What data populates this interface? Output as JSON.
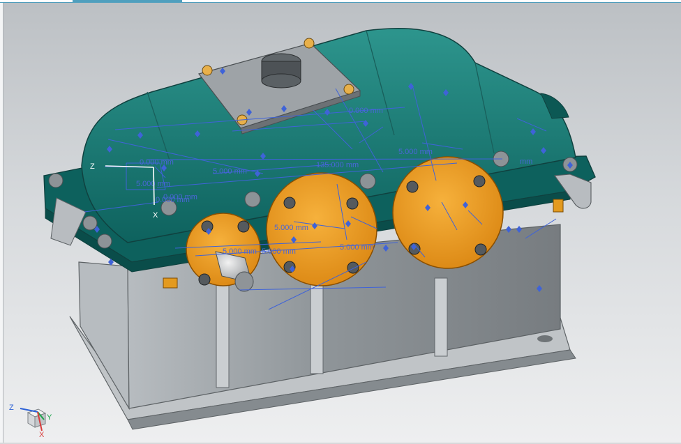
{
  "colors": {
    "housing_green": "#0f6b67",
    "housing_green_light": "#2a8f88",
    "body_grey": "#8e9396",
    "bearing_orange": "#e89a1c",
    "dimension_blue": "#3f63d8",
    "tab_accent": "#4f9fbe"
  },
  "icons": {
    "model": "gear-reducer-model",
    "triad": "axis-triad-icon",
    "wcs": "wcs-icon"
  },
  "dimensions": [
    "0.000 mm",
    "5.000 mm",
    "135.000 mm",
    "5.000 mm",
    "0.000 mm",
    "5.000 mm",
    "5.000 mm",
    "5.000 mm",
    "5.000 mm",
    "5.000 mm",
    "0.000 mm",
    "0.000 mm",
    "mm"
  ],
  "wcs": {
    "z": "Z",
    "x": "X"
  },
  "triad": {
    "z": "Z",
    "y": "Y",
    "x": "X"
  }
}
